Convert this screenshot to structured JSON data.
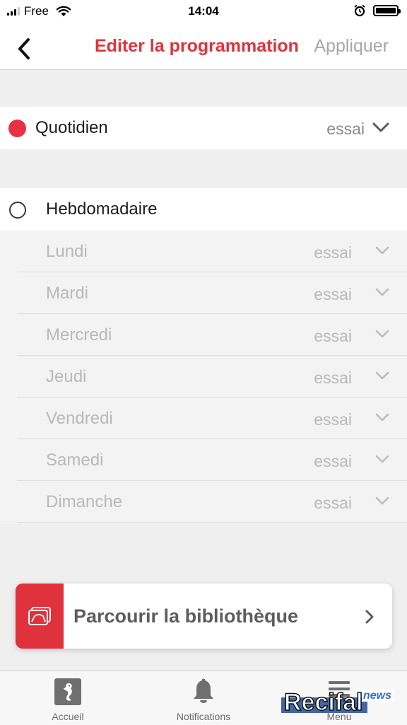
{
  "status_bar": {
    "carrier": "Free",
    "time": "14:04"
  },
  "nav": {
    "title": "Editer la programmation",
    "apply_label": "Appliquer"
  },
  "schedule": {
    "daily": {
      "label": "Quotidien",
      "value": "essai",
      "selected": true
    },
    "weekly": {
      "label": "Hebdomadaire",
      "selected": false
    },
    "days": [
      {
        "label": "Lundi",
        "value": "essai"
      },
      {
        "label": "Mardi",
        "value": "essai"
      },
      {
        "label": "Mercredi",
        "value": "essai"
      },
      {
        "label": "Jeudi",
        "value": "essai"
      },
      {
        "label": "Vendredi",
        "value": "essai"
      },
      {
        "label": "Samedi",
        "value": "essai"
      },
      {
        "label": "Dimanche",
        "value": "essai"
      }
    ]
  },
  "library": {
    "label": "Parcourir la bibliothèque"
  },
  "tab_bar": {
    "tabs": [
      {
        "label": "Accueil",
        "icon": "seahorse-icon"
      },
      {
        "label": "Notifications",
        "icon": "bell-icon"
      },
      {
        "label": "Menu",
        "icon": "menu-icon"
      }
    ]
  },
  "watermark": {
    "brand": "Recifal",
    "sub": "news"
  },
  "colors": {
    "accent": "#e0323c",
    "muted": "#a7a7a7",
    "background": "#efefef"
  }
}
